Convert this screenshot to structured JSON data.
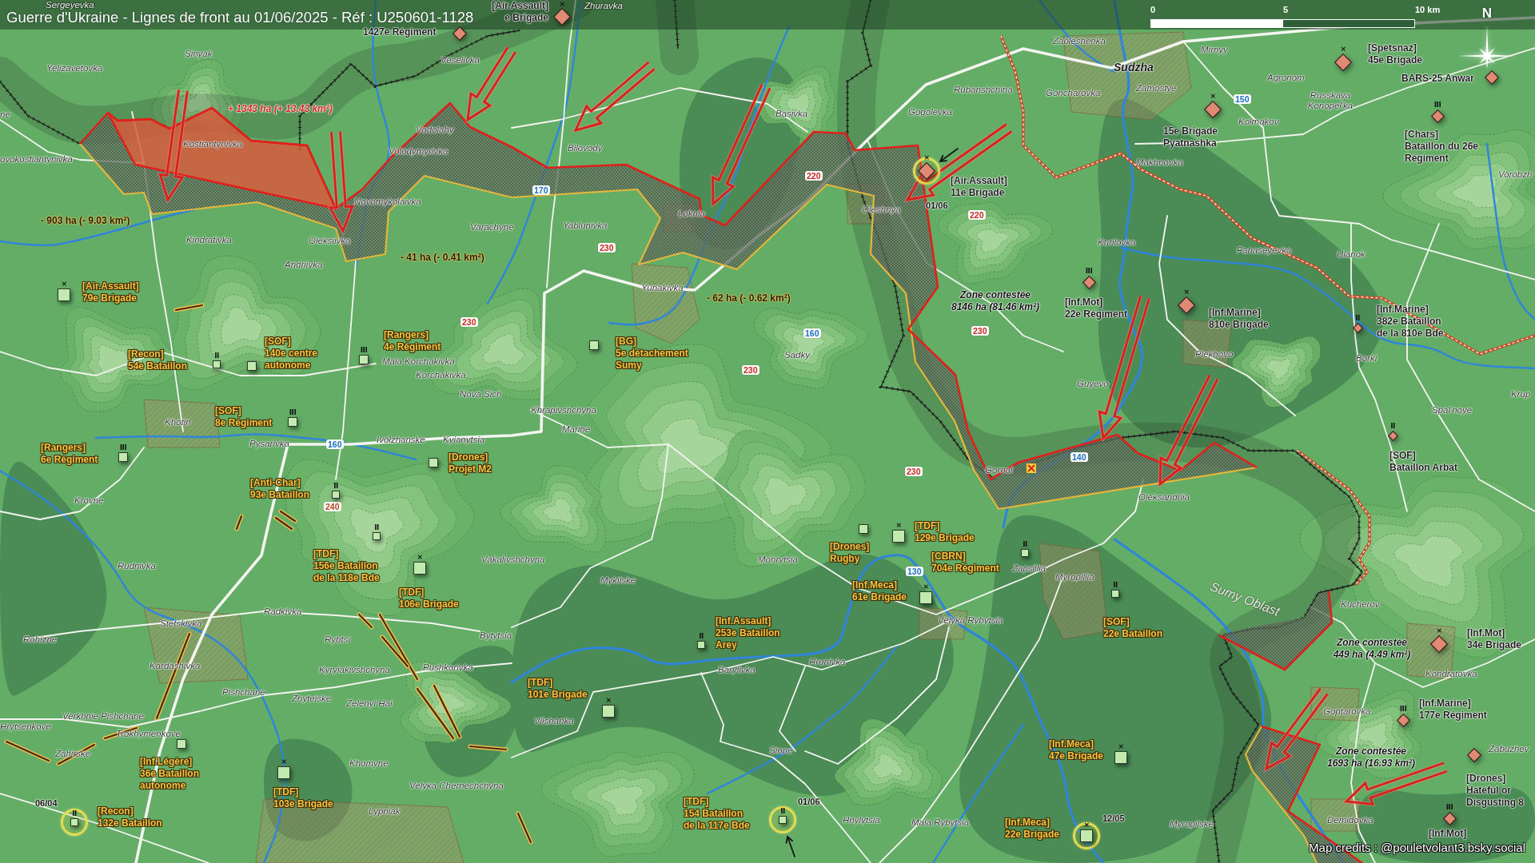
{
  "title": "Guerre d'Ukraine - Lignes de front au 01/06/2025 - Réf : U250601-1128",
  "scale_bar": {
    "labels": [
      "0",
      "5",
      "10 km"
    ]
  },
  "compass": {
    "label": "N"
  },
  "towns": [
    {
      "name": "Sergeyevka",
      "kind": "village"
    },
    {
      "name": "Zhuravka",
      "kind": "village"
    },
    {
      "name": "Zaoleshenka",
      "kind": "village"
    },
    {
      "name": "Sinyak",
      "kind": "village"
    },
    {
      "name": "Mirnyy",
      "kind": "village"
    },
    {
      "name": "Veselivka",
      "kind": "village"
    },
    {
      "name": "Yelizavetovka",
      "kind": "village"
    },
    {
      "name": "Sudzha",
      "kind": "city"
    },
    {
      "name": "Agronom",
      "kind": "village"
    },
    {
      "name": "Rubanshchina",
      "kind": "village"
    },
    {
      "name": "Goncharovka",
      "kind": "village"
    },
    {
      "name": "Zamostye",
      "kind": "village"
    },
    {
      "name": "Russkaya Konopel'ka",
      "kind": "village"
    },
    {
      "name": "ne",
      "kind": "village"
    },
    {
      "name": "Basivka",
      "kind": "village"
    },
    {
      "name": "Gogolevka",
      "kind": "village"
    },
    {
      "name": "Kolmakov",
      "kind": "village"
    },
    {
      "name": "Vodolahy",
      "kind": "village"
    },
    {
      "name": "Kostiantynivka",
      "kind": "village"
    },
    {
      "name": "Volodymyrivka",
      "kind": "village"
    },
    {
      "name": "Bilovody",
      "kind": "village"
    },
    {
      "name": "ovokostiantynivka",
      "kind": "village"
    },
    {
      "name": "Makhnovka",
      "kind": "village"
    },
    {
      "name": "Vorobzh",
      "kind": "village"
    },
    {
      "name": "Novomykolaivka",
      "kind": "village"
    },
    {
      "name": "Loknia",
      "kind": "village"
    },
    {
      "name": "Oleshnya",
      "kind": "village"
    },
    {
      "name": "Varachyne",
      "kind": "village"
    },
    {
      "name": "Yablunivka",
      "kind": "village"
    },
    {
      "name": "Kindrativka",
      "kind": "village"
    },
    {
      "name": "Oleksiivka",
      "kind": "village"
    },
    {
      "name": "Kurilovka",
      "kind": "village"
    },
    {
      "name": "Fanaseyevka",
      "kind": "village"
    },
    {
      "name": "Ulanok",
      "kind": "village"
    },
    {
      "name": "Andriivka",
      "kind": "village"
    },
    {
      "name": "Yunakivka",
      "kind": "village"
    },
    {
      "name": "Mala Korchakivka",
      "kind": "village"
    },
    {
      "name": "Sadky",
      "kind": "village"
    },
    {
      "name": "Plekhovo",
      "kind": "village"
    },
    {
      "name": "Borki",
      "kind": "village"
    },
    {
      "name": "Korchakivka",
      "kind": "village"
    },
    {
      "name": "Guyevo",
      "kind": "village"
    },
    {
      "name": "Nova Sich",
      "kind": "village"
    },
    {
      "name": "Krup",
      "kind": "village"
    },
    {
      "name": "Khrapivshchyna",
      "kind": "village"
    },
    {
      "name": "Spal'noye",
      "kind": "village"
    },
    {
      "name": "Khotin",
      "kind": "village"
    },
    {
      "name": "Marine",
      "kind": "village"
    },
    {
      "name": "Pysarivka",
      "kind": "village"
    },
    {
      "name": "Ivolzhanske",
      "kind": "village"
    },
    {
      "name": "Kyianytsia",
      "kind": "village"
    },
    {
      "name": "Gornal",
      "kind": "village"
    },
    {
      "name": "Krovne",
      "kind": "village"
    },
    {
      "name": "Oleksandriia",
      "kind": "village"
    },
    {
      "name": "Rudnivka",
      "kind": "village"
    },
    {
      "name": "Vakalivshchyna",
      "kind": "village"
    },
    {
      "name": "Mohrytsia",
      "kind": "village"
    },
    {
      "name": "Zapsillia",
      "kind": "village"
    },
    {
      "name": "Mykilske",
      "kind": "village"
    },
    {
      "name": "Myropillia",
      "kind": "village"
    },
    {
      "name": "Kucherov",
      "kind": "village"
    },
    {
      "name": "Radkivka",
      "kind": "village"
    },
    {
      "name": "Stetskivka",
      "kind": "village"
    },
    {
      "name": "Velyka Rybytsia",
      "kind": "village"
    },
    {
      "name": "Rohizne",
      "kind": "village"
    },
    {
      "name": "Rybtsi",
      "kind": "village"
    },
    {
      "name": "Bytytsia",
      "kind": "village"
    },
    {
      "name": "Kardashivka",
      "kind": "village"
    },
    {
      "name": "Kyryiakivshchyna",
      "kind": "village"
    },
    {
      "name": "Pushkarivka",
      "kind": "village"
    },
    {
      "name": "Barylivka",
      "kind": "village"
    },
    {
      "name": "Hrunivka",
      "kind": "village"
    },
    {
      "name": "Kondratovka",
      "kind": "village"
    },
    {
      "name": "Pishchane",
      "kind": "village"
    },
    {
      "name": "Zhyteiske",
      "kind": "village"
    },
    {
      "name": "Zelenyi Hai",
      "kind": "village"
    },
    {
      "name": "Verkhnie Pishchane",
      "kind": "village"
    },
    {
      "name": "Goptarovka",
      "kind": "village"
    },
    {
      "name": "Hrytsenkove",
      "kind": "village"
    },
    {
      "name": "Vilshanka",
      "kind": "village"
    },
    {
      "name": "Trokhymenkove",
      "kind": "village"
    },
    {
      "name": "Zahirske",
      "kind": "village"
    },
    {
      "name": "Sinne",
      "kind": "village"
    },
    {
      "name": "Zabuzhev",
      "kind": "village"
    },
    {
      "name": "Khomyne",
      "kind": "village"
    },
    {
      "name": "Velyka Chernechchyna",
      "kind": "village"
    },
    {
      "name": "Lypniak",
      "kind": "village"
    },
    {
      "name": "Hnylytsia",
      "kind": "village"
    },
    {
      "name": "Mala Rybytsia",
      "kind": "village"
    },
    {
      "name": "Myropilske",
      "kind": "village"
    },
    {
      "name": "Demidovka",
      "kind": "village"
    }
  ],
  "road_numbers": [
    {
      "label": "150",
      "color": "#1c6fc2"
    },
    {
      "label": "220",
      "color": "#c62a1e"
    },
    {
      "label": "170",
      "color": "#1c6fc2"
    },
    {
      "label": "220",
      "color": "#c62a1e"
    },
    {
      "label": "230",
      "color": "#c62a1e"
    },
    {
      "label": "230",
      "color": "#c62a1e"
    },
    {
      "label": "160",
      "color": "#1c6fc2"
    },
    {
      "label": "230",
      "color": "#c62a1e"
    },
    {
      "label": "230",
      "color": "#c62a1e"
    },
    {
      "label": "160",
      "color": "#1c6fc2"
    },
    {
      "label": "140",
      "color": "#1c6fc2"
    },
    {
      "label": "230",
      "color": "#c62a1e"
    },
    {
      "label": "240",
      "color": "#b5471f"
    },
    {
      "label": "130",
      "color": "#1c6fc2"
    }
  ],
  "area_changes": [
    {
      "kind": "gain",
      "label": "+ 1343 ha (+ 13.43 km²)"
    },
    {
      "kind": "loss",
      "label": "- 903 ha (- 9.03 km²)"
    },
    {
      "kind": "loss",
      "label": "- 41 ha (- 0.41 km²)"
    },
    {
      "kind": "loss",
      "label": "- 62 ha (- 0.62 km²)"
    }
  ],
  "contested_zones": [
    {
      "lines": [
        "Zone contestée",
        "8146 ha (81.46 km²)"
      ]
    },
    {
      "lines": [
        "Zone contestée",
        "449 ha (4.49 km²)"
      ]
    },
    {
      "lines": [
        "Zone contestée",
        "1693 ha (16.93 km²)"
      ]
    }
  ],
  "region_label": "Sumy Oblast",
  "units": [
    {
      "kind": "russian",
      "echelon": "×",
      "lines": [
        "[Air.Assault]",
        "e Brigade"
      ],
      "highlighted": false
    },
    {
      "kind": "russian",
      "lines": [
        "1427e Régiment"
      ],
      "highlighted": false
    },
    {
      "kind": "russian",
      "echelon": "×",
      "lines": [
        "[Spetsnaz]",
        "45e Brigade"
      ],
      "highlighted": false
    },
    {
      "kind": "russian",
      "lines": [
        "BARS-25 Anwar"
      ],
      "highlighted": false
    },
    {
      "kind": "russian",
      "echelon": "×",
      "lines": [
        "15e Brigade",
        "Pyatnashka"
      ],
      "highlighted": false
    },
    {
      "kind": "russian",
      "echelon": "III",
      "lines": [
        "[Chars]",
        "Bataillon du 26e",
        "Régiment"
      ],
      "highlighted": false
    },
    {
      "kind": "russian",
      "echelon": "×",
      "lines": [
        "[Air.Assault]",
        "11e Brigade"
      ],
      "highlighted": true,
      "date": "01/06"
    },
    {
      "kind": "ukrainian",
      "echelon": "×",
      "lines": [
        "[Air.Assault]",
        "79e Brigade"
      ],
      "highlighted": false
    },
    {
      "kind": "russian",
      "echelon": "III",
      "lines": [
        "[Inf.Mot]",
        "22e Régiment"
      ],
      "highlighted": false
    },
    {
      "kind": "russian",
      "echelon": "×",
      "lines": [
        "[Inf.Marine]",
        "810e Brigade"
      ],
      "highlighted": false
    },
    {
      "kind": "russian",
      "echelon": "II",
      "lines": [
        "[Inf.Marine]",
        "382e Bataillon",
        "de la 810e Bde"
      ],
      "highlighted": false
    },
    {
      "kind": "ukrainian",
      "echelon": "II",
      "lines": [
        "[Recon]",
        "54e Bataillon"
      ],
      "highlighted": false
    },
    {
      "kind": "ukrainian",
      "lines": [
        "[SOF]",
        "140e centre",
        "autonome"
      ],
      "highlighted": false
    },
    {
      "kind": "ukrainian",
      "echelon": "III",
      "lines": [
        "[Rangers]",
        "4e Régiment"
      ],
      "highlighted": false
    },
    {
      "kind": "ukrainian",
      "lines": [
        "[BG]",
        "5e détachement",
        "Sumy"
      ],
      "highlighted": false
    },
    {
      "kind": "ukrainian",
      "echelon": "III",
      "lines": [
        "[SOF]",
        "8e Régiment"
      ],
      "highlighted": false
    },
    {
      "kind": "ukrainian",
      "echelon": "III",
      "lines": [
        "[Rangers]",
        "6e Régiment"
      ],
      "highlighted": false
    },
    {
      "kind": "ukrainian",
      "lines": [
        "[Drones]",
        "Projet M2"
      ],
      "highlighted": false
    },
    {
      "kind": "russian",
      "echelon": "II",
      "lines": [
        "[SOF]",
        "Bataillon Arbat"
      ],
      "highlighted": false
    },
    {
      "kind": "ukrainian",
      "echelon": "II",
      "lines": [
        "[Anti-Char]",
        "93e Bataillon"
      ],
      "highlighted": false
    },
    {
      "kind": "ukrainian",
      "echelon": "II",
      "lines": [
        "[TDF]",
        "156e Bataillon",
        "de la 118e Bde"
      ],
      "highlighted": false
    },
    {
      "kind": "ukrainian",
      "lines": [
        "[Drones]",
        "Rugby"
      ],
      "highlighted": false
    },
    {
      "kind": "ukrainian",
      "echelon": "×",
      "lines": [
        "[TDF]",
        "129e Brigade"
      ],
      "highlighted": false
    },
    {
      "kind": "ukrainian",
      "echelon": "×",
      "lines": [
        "[TDF]",
        "106e Brigade"
      ],
      "highlighted": false
    },
    {
      "kind": "ukrainian",
      "echelon": "II",
      "lines": [
        "[CBRN]",
        "704e Régiment"
      ],
      "highlighted": false
    },
    {
      "kind": "ukrainian",
      "echelon": "×",
      "lines": [
        "[Inf.Meca]",
        "61e Brigade"
      ],
      "highlighted": false
    },
    {
      "kind": "ukrainian",
      "echelon": "II",
      "lines": [
        "[Inf.Assault]",
        "253e Bataillon",
        "Arey"
      ],
      "highlighted": false
    },
    {
      "kind": "ukrainian",
      "echelon": "II",
      "lines": [
        "[SOF]",
        "22e Bataillon"
      ],
      "highlighted": false
    },
    {
      "kind": "russian",
      "echelon": "×",
      "lines": [
        "[Inf.Mot]",
        "34e Brigade"
      ],
      "highlighted": false
    },
    {
      "kind": "ukrainian",
      "echelon": "×",
      "lines": [
        "[TDF]",
        "101e Brigade"
      ],
      "highlighted": false
    },
    {
      "kind": "russian",
      "echelon": "III",
      "lines": [
        "[Inf.Marine]",
        "177e Régiment"
      ],
      "highlighted": false
    },
    {
      "kind": "ukrainian",
      "lines": [
        "[Inf.Légère]",
        "36e Bataillon",
        "autonome"
      ],
      "highlighted": false
    },
    {
      "kind": "ukrainian",
      "echelon": "×",
      "lines": [
        "[TDF]",
        "103e Brigade"
      ],
      "highlighted": false
    },
    {
      "kind": "ukrainian",
      "echelon": "×",
      "lines": [
        "[Inf.Meca]",
        "47e Brigade"
      ],
      "highlighted": false
    },
    {
      "kind": "russian",
      "lines": [
        "[Drones]",
        "Hateful or",
        "Disgusting 8"
      ],
      "highlighted": false
    },
    {
      "kind": "ukrainian",
      "echelon": "II",
      "lines": [
        "[Recon]",
        "132e Bataillon"
      ],
      "highlighted": true,
      "date": "06/04"
    },
    {
      "kind": "ukrainian",
      "echelon": "II",
      "lines": [
        "[TDF]",
        "154 Bataillon",
        "de la 117e Bde"
      ],
      "highlighted": true,
      "date": "01/06"
    },
    {
      "kind": "ukrainian",
      "echelon": "×",
      "lines": [
        "[Inf.Meca]",
        "22e Brigade"
      ],
      "highlighted": true,
      "date": "12/05"
    },
    {
      "kind": "russian",
      "echelon": "III",
      "lines": [
        "[Inf.Mot]"
      ],
      "highlighted": false
    }
  ],
  "credits": "Map credits : @pouletvolant3.bsky.social"
}
